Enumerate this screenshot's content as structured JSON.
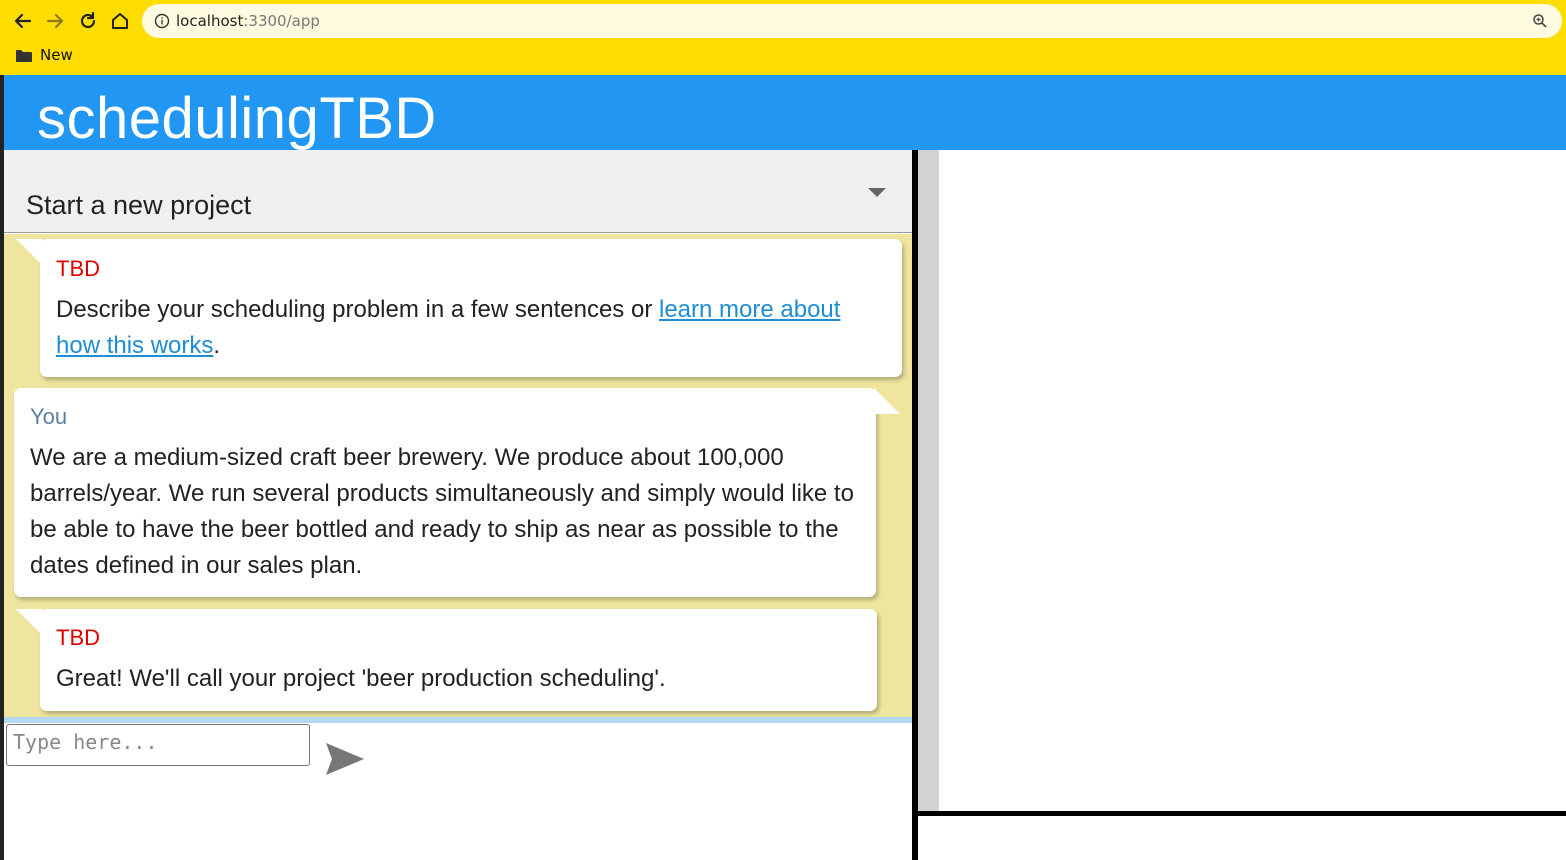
{
  "browser": {
    "url_host": "localhost",
    "url_path": ":3300/app",
    "bookmark_label": "New",
    "colors": {
      "chrome": "#ffdd00",
      "url_bar": "#fffbe0"
    },
    "icons": [
      "back-arrow-icon",
      "forward-arrow-icon",
      "reload-icon",
      "home-icon",
      "site-info-icon",
      "zoom-icon",
      "folder-icon"
    ]
  },
  "app": {
    "title": "schedulingTBD",
    "header_color": "#2196f3"
  },
  "project": {
    "selected": "Start a new project"
  },
  "conversation": [
    {
      "speaker": "TBD",
      "text_before_link": "Describe your scheduling problem in a few sentences or ",
      "link_text": "learn more about how this works",
      "text_after_link": "."
    },
    {
      "speaker": "You",
      "text": "We are a medium-sized craft beer brewery. We produce about 100,000 barrels/year. We run several products simultaneously and simply would like to be able to have the beer bottled and ready to ship as near as possible to the dates defined in our sales plan."
    },
    {
      "speaker": "TBD",
      "text": "Great! We'll call your project 'beer production scheduling'."
    }
  ],
  "chat_input": {
    "placeholder": "Type here...",
    "value": ""
  },
  "colors": {
    "chat_background": "#efe59f",
    "tbd_name": "#e00000",
    "you_name": "#5a7fa0",
    "link": "#1f8dd6"
  }
}
